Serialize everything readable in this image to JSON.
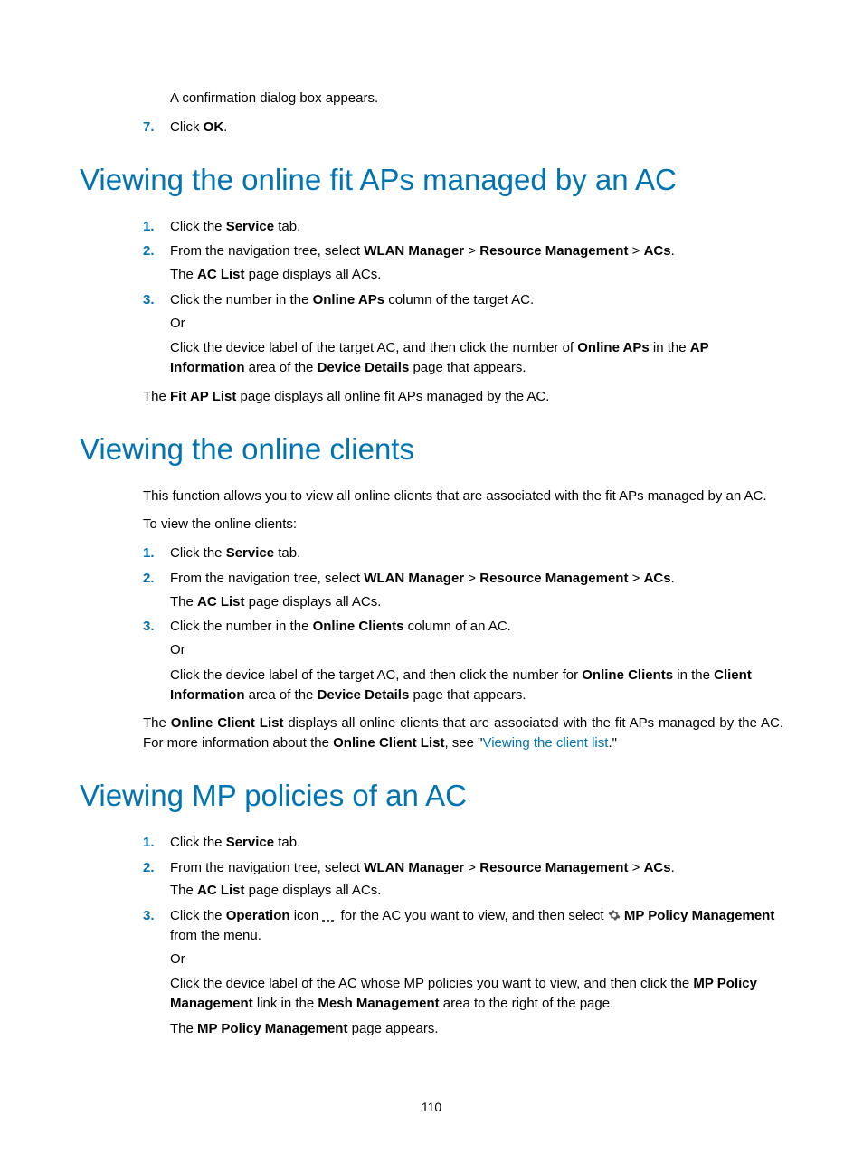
{
  "intro": {
    "confirm": "A confirmation dialog box appears.",
    "step7_num": "7.",
    "step7_a": "Click ",
    "step7_b": "OK",
    "step7_c": "."
  },
  "sec1": {
    "heading": "Viewing the online fit APs managed by an AC",
    "s1_num": "1.",
    "s1_a": "Click the ",
    "s1_b": "Service",
    "s1_c": " tab.",
    "s2_num": "2.",
    "s2_a": "From the navigation tree, select ",
    "s2_b": "WLAN Manager",
    "s2_c": " > ",
    "s2_d": "Resource Management",
    "s2_e": " > ",
    "s2_f": "ACs",
    "s2_g": ".",
    "s2_sub_a": "The ",
    "s2_sub_b": "AC List",
    "s2_sub_c": " page displays all ACs.",
    "s3_num": "3.",
    "s3_a": "Click the number in the ",
    "s3_b": "Online APs",
    "s3_c": " column of the target AC.",
    "s3_or": "Or",
    "s3_p2_a": "Click the device label of the target AC, and then click the number of ",
    "s3_p2_b": "Online APs",
    "s3_p2_c": " in the ",
    "s3_p2_d": "AP Information",
    "s3_p2_e": " area of the ",
    "s3_p2_f": "Device Details",
    "s3_p2_g": " page that appears.",
    "after_a": "The ",
    "after_b": "Fit AP List",
    "after_c": " page displays all online fit APs managed by the AC."
  },
  "sec2": {
    "heading": "Viewing the online clients",
    "intro": "This function allows you to view all online clients that are associated with the fit APs managed by an AC.",
    "lead": "To view the online clients:",
    "s1_num": "1.",
    "s1_a": "Click the ",
    "s1_b": "Service",
    "s1_c": " tab.",
    "s2_num": "2.",
    "s2_a": "From the navigation tree, select ",
    "s2_b": "WLAN Manager",
    "s2_c": " > ",
    "s2_d": "Resource Management",
    "s2_e": " > ",
    "s2_f": "ACs",
    "s2_g": ".",
    "s2_sub_a": "The ",
    "s2_sub_b": "AC List",
    "s2_sub_c": " page displays all ACs.",
    "s3_num": "3.",
    "s3_a": "Click the number in the ",
    "s3_b": "Online Clients",
    "s3_c": " column of an AC.",
    "s3_or": "Or",
    "s3_p2_a": "Click the device label of the target AC, and then click the number for ",
    "s3_p2_b": "Online Clients",
    "s3_p2_c": " in the ",
    "s3_p2_d": "Client Information",
    "s3_p2_e": " area of the ",
    "s3_p2_f": "Device Details",
    "s3_p2_g": " page that appears.",
    "after_a": "The ",
    "after_b": "Online Client List",
    "after_c": " displays all online clients that are associated with the fit APs managed by the AC. For more information about the ",
    "after_d": "Online Client List",
    "after_e": ", see \"",
    "after_link": "Viewing the client list",
    "after_f": ".\""
  },
  "sec3": {
    "heading": "Viewing MP policies of an AC",
    "s1_num": "1.",
    "s1_a": "Click the ",
    "s1_b": "Service",
    "s1_c": " tab.",
    "s2_num": "2.",
    "s2_a": "From the navigation tree, select ",
    "s2_b": "WLAN Manager",
    "s2_c": " > ",
    "s2_d": "Resource Management",
    "s2_e": " > ",
    "s2_f": "ACs",
    "s2_g": ".",
    "s2_sub_a": "The ",
    "s2_sub_b": "AC List",
    "s2_sub_c": " page displays all ACs.",
    "s3_num": "3.",
    "s3_a": "Click the ",
    "s3_b": "Operation",
    "s3_c": " icon ",
    "s3_d": " for the AC you want to view, and then select ",
    "s3_e": " MP Policy Management",
    "s3_f": " from the menu.",
    "s3_or": "Or",
    "s3_p2_a": "Click the device label of the AC whose MP policies you want to view, and then click the ",
    "s3_p2_b": "MP Policy Management",
    "s3_p2_c": " link in the ",
    "s3_p2_d": "Mesh Management",
    "s3_p2_e": " area to the right of the page.",
    "s3_p3_a": "The ",
    "s3_p3_b": "MP Policy Management",
    "s3_p3_c": " page appears."
  },
  "pagenum": "110"
}
